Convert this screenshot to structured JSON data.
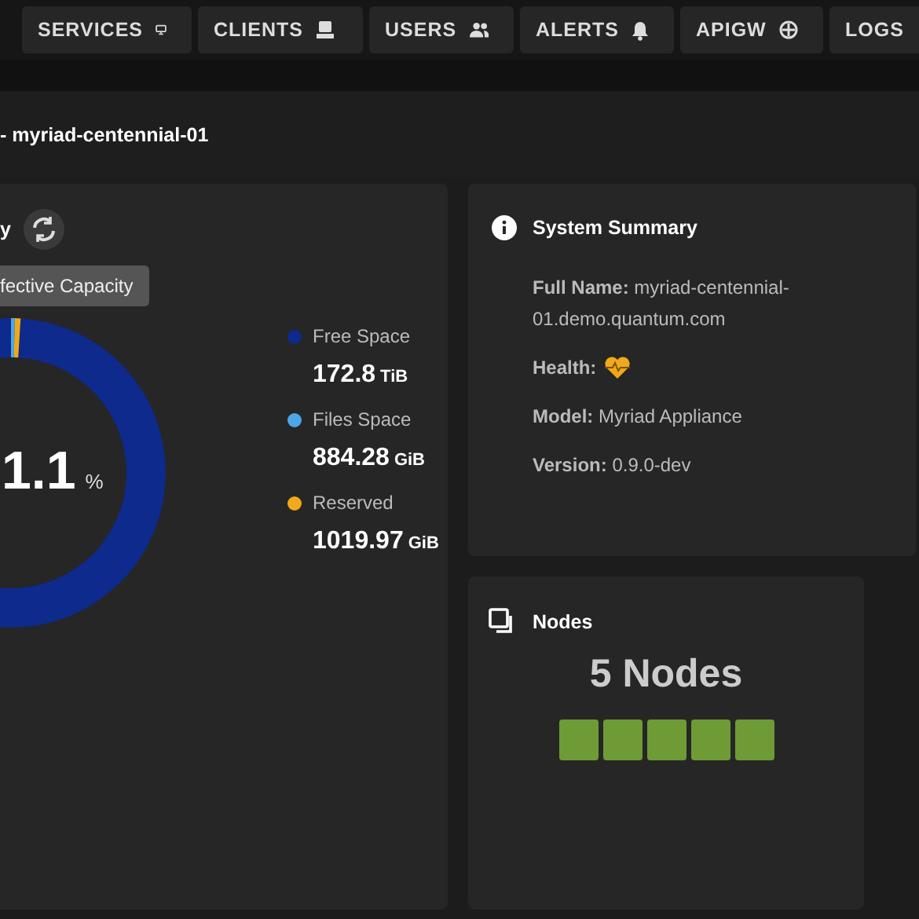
{
  "nav_tabs": [
    {
      "label": "SERVICES",
      "selected": false
    },
    {
      "label": "CLIENTS",
      "selected": false
    },
    {
      "label": "USERS",
      "selected": false
    },
    {
      "label": "ALERTS",
      "selected": false
    },
    {
      "label": "APIGW",
      "selected": false
    },
    {
      "label": "LOGS",
      "selected": false
    }
  ],
  "page_title": "- myriad-centennial-01",
  "capacity_panel": {
    "title": "y",
    "tooltip": "fective Capacity",
    "percent": "1.1",
    "percent_unit": "%",
    "legend": [
      {
        "label": "Free Space",
        "value": "172.8",
        "unit": "TiB",
        "color": "#0d2a8c"
      },
      {
        "label": "Files Space",
        "value": "884.28",
        "unit": "GiB",
        "color": "#4aa8e8"
      },
      {
        "label": "Reserved",
        "value": "1019.97",
        "unit": "GiB",
        "color": "#f0a91a"
      }
    ]
  },
  "system_summary": {
    "title": "System Summary",
    "rows": [
      {
        "kind": "text",
        "label": "Full Name:",
        "value": "myriad-centennial-01.demo.quantum.com"
      },
      {
        "kind": "health",
        "label": "Health:",
        "color": "#f0a91a"
      },
      {
        "kind": "text",
        "label": "Model:",
        "value": "Myriad Appliance"
      },
      {
        "kind": "text",
        "label": "Version:",
        "value": "0.9.0-dev"
      }
    ]
  },
  "nodes_panel": {
    "title": "Nodes",
    "count": "5 Nodes",
    "nodes": [
      {
        "color": "#6e9b35"
      },
      {
        "color": "#6e9b35"
      },
      {
        "color": "#6e9b35"
      },
      {
        "color": "#6e9b35"
      },
      {
        "color": "#6e9b35"
      }
    ]
  }
}
